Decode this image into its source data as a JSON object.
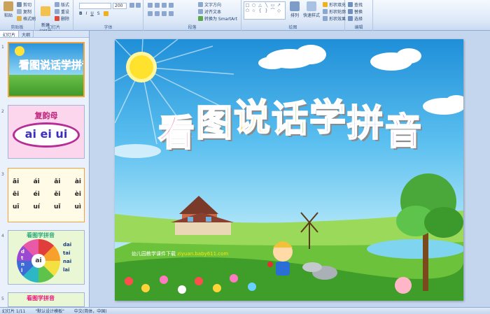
{
  "ribbon": {
    "clipboard": {
      "paste": "粘贴",
      "cut": "剪切",
      "copy": "复制",
      "format_painter": "格式刷",
      "label": "剪贴板"
    },
    "slides": {
      "new_slide": "新建\n幻灯片",
      "layout": "版式",
      "reset": "重设",
      "delete": "删除",
      "label": "幻灯片"
    },
    "font": {
      "size": "200",
      "label": "字体"
    },
    "paragraph": {
      "text_direction": "文字方向",
      "align_text": "对齐文本",
      "smartart": "转换为 SmartArt",
      "label": "段落"
    },
    "drawing": {
      "arrange": "排列",
      "quick_styles": "快速样式",
      "shape_fill": "形状填充",
      "shape_outline": "形状轮廓",
      "shape_effects": "形状效果",
      "label": "绘图"
    },
    "editing": {
      "find": "查找",
      "replace": "替换",
      "select": "选择",
      "label": "编辑"
    }
  },
  "pane": {
    "tabs": [
      "幻灯片",
      "大纲"
    ],
    "thumbnails": [
      {
        "num": "1",
        "title": "看图说话学拼音"
      },
      {
        "num": "2",
        "title": "复韵母",
        "letters": "ai ei ui"
      },
      {
        "num": "3",
        "rows": [
          [
            "āi",
            "ái",
            "ǎi",
            "ài"
          ],
          [
            "ēi",
            "éi",
            "ěi",
            "èi"
          ],
          [
            "uī",
            "uí",
            "uǐ",
            "uì"
          ]
        ]
      },
      {
        "num": "4",
        "title": "看图学拼音",
        "center": "ai",
        "spokes": [
          "dai",
          "tai",
          "nai",
          "lai",
          "d",
          "t",
          "n",
          "l"
        ]
      },
      {
        "num": "5",
        "title": "看图学拼音"
      }
    ]
  },
  "slide": {
    "title_chars": [
      "看",
      "图",
      "说",
      "话",
      "学",
      "拼",
      "音"
    ],
    "title_colors": [
      "#e8187c",
      "#f26a10",
      "#f7c400",
      "#73c51c",
      "#1eb4ad",
      "#3b5fd6",
      "#8a2dc8"
    ],
    "footer_text": "幼儿园教学课件下载",
    "footer_url": "ziyuan.baby611.com"
  },
  "status": {
    "slide_info": "幻灯片 1/11",
    "theme": "\"默认设计模板\"",
    "language": "中文(简体，中国)"
  }
}
